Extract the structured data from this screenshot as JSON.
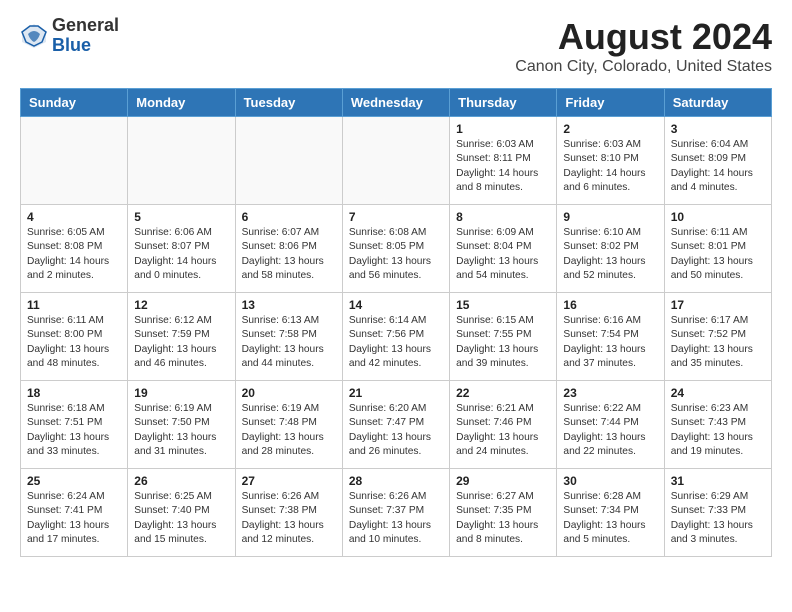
{
  "header": {
    "logo_line1": "General",
    "logo_line2": "Blue",
    "title": "August 2024",
    "subtitle": "Canon City, Colorado, United States"
  },
  "calendar": {
    "headers": [
      "Sunday",
      "Monday",
      "Tuesday",
      "Wednesday",
      "Thursday",
      "Friday",
      "Saturday"
    ],
    "weeks": [
      [
        {
          "day": "",
          "info": ""
        },
        {
          "day": "",
          "info": ""
        },
        {
          "day": "",
          "info": ""
        },
        {
          "day": "",
          "info": ""
        },
        {
          "day": "1",
          "info": "Sunrise: 6:03 AM\nSunset: 8:11 PM\nDaylight: 14 hours\nand 8 minutes."
        },
        {
          "day": "2",
          "info": "Sunrise: 6:03 AM\nSunset: 8:10 PM\nDaylight: 14 hours\nand 6 minutes."
        },
        {
          "day": "3",
          "info": "Sunrise: 6:04 AM\nSunset: 8:09 PM\nDaylight: 14 hours\nand 4 minutes."
        }
      ],
      [
        {
          "day": "4",
          "info": "Sunrise: 6:05 AM\nSunset: 8:08 PM\nDaylight: 14 hours\nand 2 minutes."
        },
        {
          "day": "5",
          "info": "Sunrise: 6:06 AM\nSunset: 8:07 PM\nDaylight: 14 hours\nand 0 minutes."
        },
        {
          "day": "6",
          "info": "Sunrise: 6:07 AM\nSunset: 8:06 PM\nDaylight: 13 hours\nand 58 minutes."
        },
        {
          "day": "7",
          "info": "Sunrise: 6:08 AM\nSunset: 8:05 PM\nDaylight: 13 hours\nand 56 minutes."
        },
        {
          "day": "8",
          "info": "Sunrise: 6:09 AM\nSunset: 8:04 PM\nDaylight: 13 hours\nand 54 minutes."
        },
        {
          "day": "9",
          "info": "Sunrise: 6:10 AM\nSunset: 8:02 PM\nDaylight: 13 hours\nand 52 minutes."
        },
        {
          "day": "10",
          "info": "Sunrise: 6:11 AM\nSunset: 8:01 PM\nDaylight: 13 hours\nand 50 minutes."
        }
      ],
      [
        {
          "day": "11",
          "info": "Sunrise: 6:11 AM\nSunset: 8:00 PM\nDaylight: 13 hours\nand 48 minutes."
        },
        {
          "day": "12",
          "info": "Sunrise: 6:12 AM\nSunset: 7:59 PM\nDaylight: 13 hours\nand 46 minutes."
        },
        {
          "day": "13",
          "info": "Sunrise: 6:13 AM\nSunset: 7:58 PM\nDaylight: 13 hours\nand 44 minutes."
        },
        {
          "day": "14",
          "info": "Sunrise: 6:14 AM\nSunset: 7:56 PM\nDaylight: 13 hours\nand 42 minutes."
        },
        {
          "day": "15",
          "info": "Sunrise: 6:15 AM\nSunset: 7:55 PM\nDaylight: 13 hours\nand 39 minutes."
        },
        {
          "day": "16",
          "info": "Sunrise: 6:16 AM\nSunset: 7:54 PM\nDaylight: 13 hours\nand 37 minutes."
        },
        {
          "day": "17",
          "info": "Sunrise: 6:17 AM\nSunset: 7:52 PM\nDaylight: 13 hours\nand 35 minutes."
        }
      ],
      [
        {
          "day": "18",
          "info": "Sunrise: 6:18 AM\nSunset: 7:51 PM\nDaylight: 13 hours\nand 33 minutes."
        },
        {
          "day": "19",
          "info": "Sunrise: 6:19 AM\nSunset: 7:50 PM\nDaylight: 13 hours\nand 31 minutes."
        },
        {
          "day": "20",
          "info": "Sunrise: 6:19 AM\nSunset: 7:48 PM\nDaylight: 13 hours\nand 28 minutes."
        },
        {
          "day": "21",
          "info": "Sunrise: 6:20 AM\nSunset: 7:47 PM\nDaylight: 13 hours\nand 26 minutes."
        },
        {
          "day": "22",
          "info": "Sunrise: 6:21 AM\nSunset: 7:46 PM\nDaylight: 13 hours\nand 24 minutes."
        },
        {
          "day": "23",
          "info": "Sunrise: 6:22 AM\nSunset: 7:44 PM\nDaylight: 13 hours\nand 22 minutes."
        },
        {
          "day": "24",
          "info": "Sunrise: 6:23 AM\nSunset: 7:43 PM\nDaylight: 13 hours\nand 19 minutes."
        }
      ],
      [
        {
          "day": "25",
          "info": "Sunrise: 6:24 AM\nSunset: 7:41 PM\nDaylight: 13 hours\nand 17 minutes."
        },
        {
          "day": "26",
          "info": "Sunrise: 6:25 AM\nSunset: 7:40 PM\nDaylight: 13 hours\nand 15 minutes."
        },
        {
          "day": "27",
          "info": "Sunrise: 6:26 AM\nSunset: 7:38 PM\nDaylight: 13 hours\nand 12 minutes."
        },
        {
          "day": "28",
          "info": "Sunrise: 6:26 AM\nSunset: 7:37 PM\nDaylight: 13 hours\nand 10 minutes."
        },
        {
          "day": "29",
          "info": "Sunrise: 6:27 AM\nSunset: 7:35 PM\nDaylight: 13 hours\nand 8 minutes."
        },
        {
          "day": "30",
          "info": "Sunrise: 6:28 AM\nSunset: 7:34 PM\nDaylight: 13 hours\nand 5 minutes."
        },
        {
          "day": "31",
          "info": "Sunrise: 6:29 AM\nSunset: 7:33 PM\nDaylight: 13 hours\nand 3 minutes."
        }
      ]
    ]
  }
}
